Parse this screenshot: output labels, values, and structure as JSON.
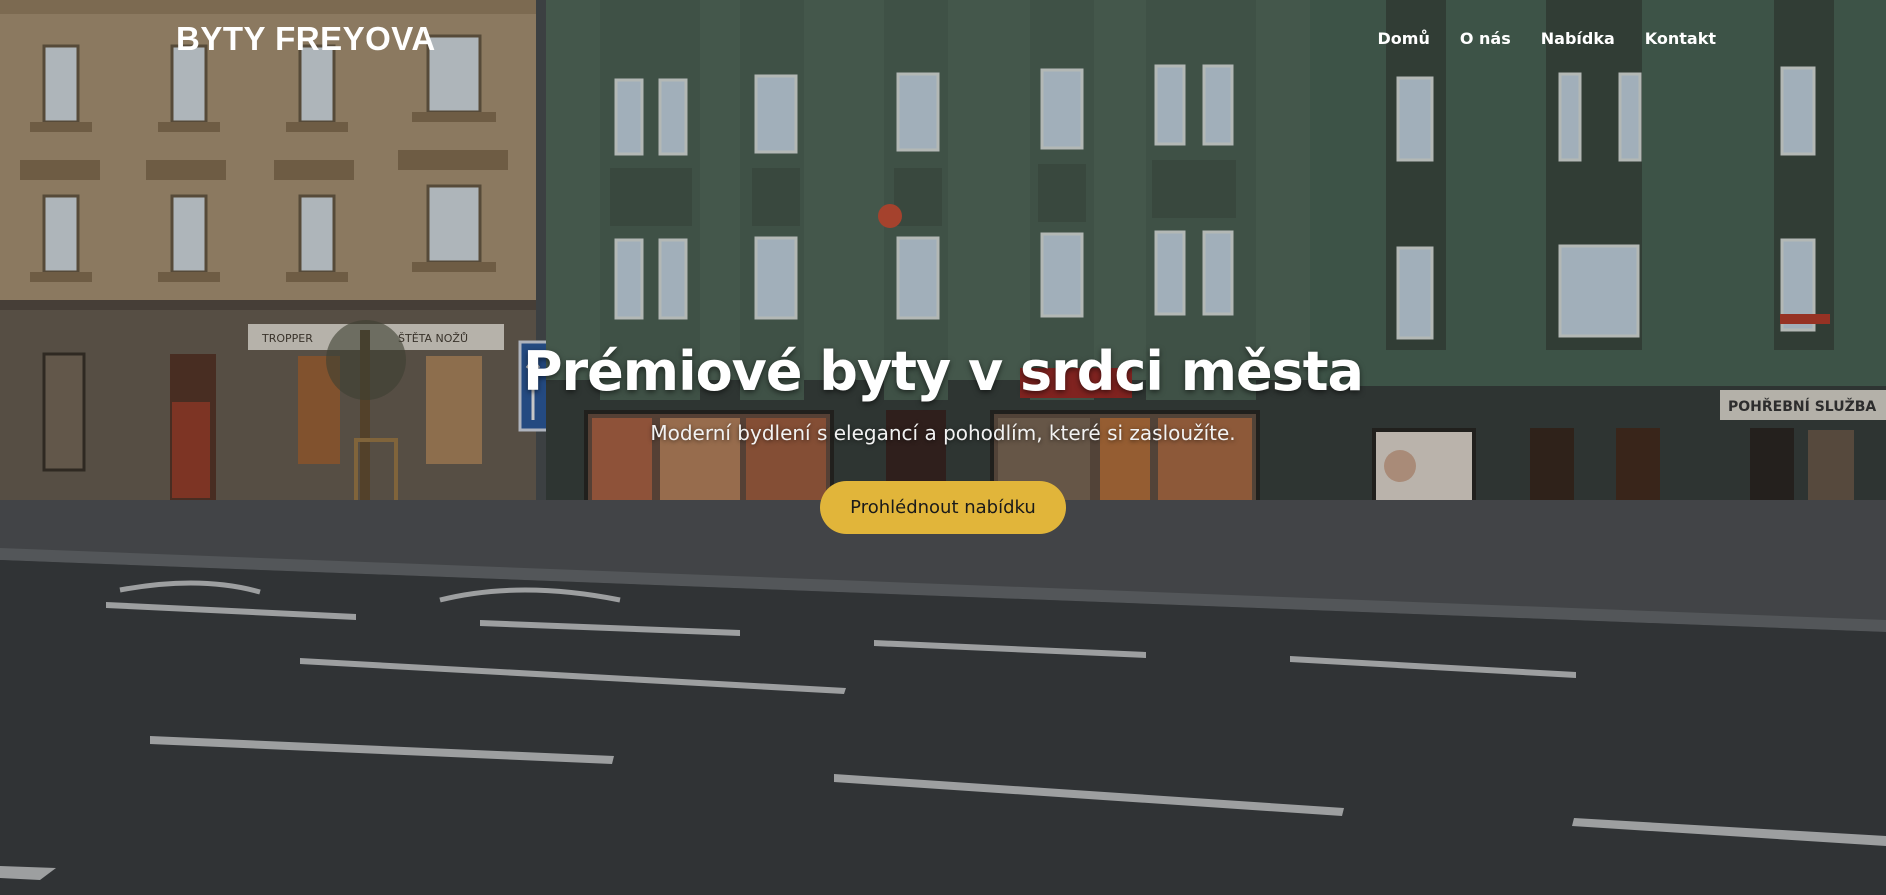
{
  "header": {
    "logo": "BYTY FREYOVA",
    "nav": [
      {
        "label": "Domů"
      },
      {
        "label": "O nás"
      },
      {
        "label": "Nabídka"
      },
      {
        "label": "Kontakt"
      }
    ]
  },
  "hero": {
    "title": "Prémiové byty v srdci města",
    "subtitle": "Moderní bydlení s elegancí a pohodlím, které si zasloužíte.",
    "cta_label": "Prohlédnout nabídku"
  },
  "background_signs": {
    "shop_left": "TROPPER",
    "shop_left_2": "ŠTĚTA NOŽŮ",
    "funeral": "POHŘEBNÍ SLUŽBA"
  },
  "colors": {
    "cta_background": "#e1b53a",
    "text": "#ffffff"
  }
}
